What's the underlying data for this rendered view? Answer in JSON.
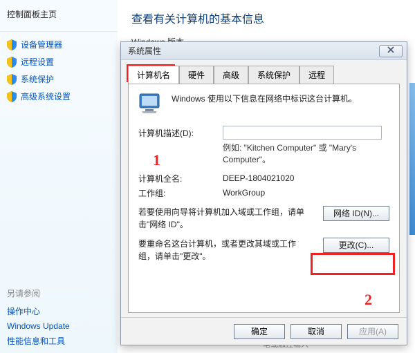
{
  "sidebar": {
    "home": "控制面板主页",
    "items": [
      {
        "label": "设备管理器"
      },
      {
        "label": "远程设置"
      },
      {
        "label": "系统保护"
      },
      {
        "label": "高级系统设置"
      }
    ],
    "see_also_header": "另请参阅",
    "see_also": [
      {
        "label": "操作中心"
      },
      {
        "label": "Windows Update"
      },
      {
        "label": "性能信息和工具"
      }
    ]
  },
  "content": {
    "page_title": "查看有关计算机的基本信息",
    "version_label": "Windows 版本",
    "bottom_hint": "笔或触控输入"
  },
  "dialog": {
    "title": "系统属性",
    "tabs": [
      {
        "label": "计算机名"
      },
      {
        "label": "硬件"
      },
      {
        "label": "高级"
      },
      {
        "label": "系统保护"
      },
      {
        "label": "远程"
      }
    ],
    "intro": "Windows 使用以下信息在网络中标识这台计算机。",
    "desc_label": "计算机描述(D):",
    "desc_value": "",
    "desc_example": "例如: \"Kitchen Computer\" 或 \"Mary's Computer\"。",
    "fullname_label": "计算机全名:",
    "fullname_value": "DEEP-1804021020",
    "workgroup_label": "工作组:",
    "workgroup_value": "WorkGroup",
    "join_text": "若要使用向导将计算机加入域或工作组，请单击\"网络 ID\"。",
    "netid_button": "网络 ID(N)...",
    "rename_text": "要重命名这台计算机，或者更改其域或工作组，请单击\"更改\"。",
    "change_button": "更改(C)...",
    "ok": "确定",
    "cancel": "取消",
    "apply": "应用(A)"
  },
  "annotations": {
    "one": "1",
    "two": "2"
  },
  "colors": {
    "link": "#0654b9",
    "accent": "#e22222"
  }
}
